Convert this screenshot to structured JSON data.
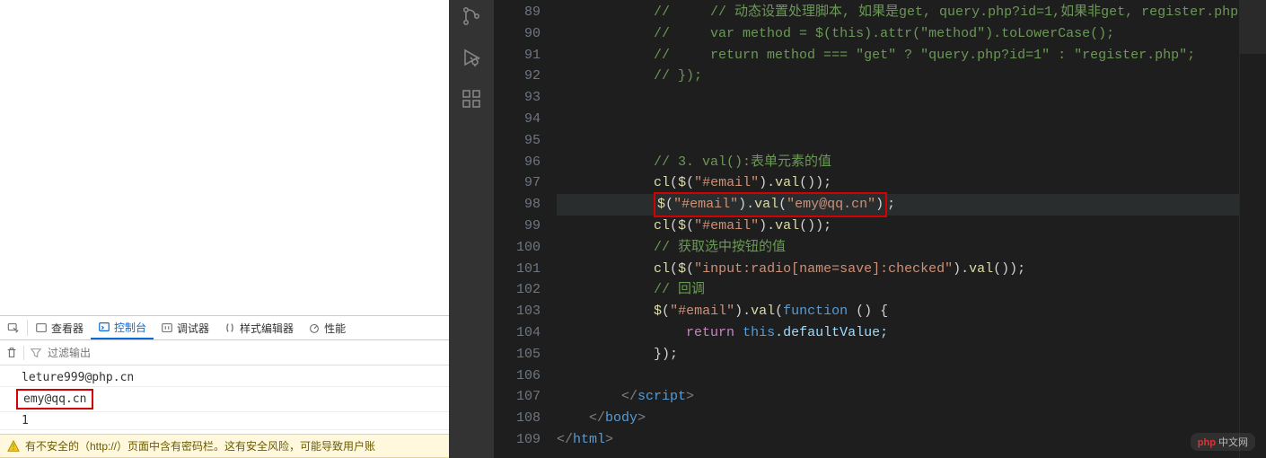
{
  "devtools": {
    "tabs": {
      "inspector": "查看器",
      "console": "控制台",
      "debugger": "调试器",
      "styleEditor": "样式编辑器",
      "performance": "性能"
    },
    "filterPlaceholder": "过滤输出",
    "console": {
      "line1": "leture999@php.cn",
      "line2": "emy@qq.cn",
      "line3": "1"
    },
    "warning": "有不安全的（http://）页面中含有密码栏。这有安全风险，可能导致用户账"
  },
  "editor": {
    "lines": {
      "89": {
        "cmt": "//     // 动态设置处理脚本, 如果是get, query.php?id=1,如果非get, register.php"
      },
      "90": {
        "cmt": "//     var method = $(this).attr(\"method\").toLowerCase();"
      },
      "91": {
        "cmt": "//     return method === \"get\" ? \"query.php?id=1\" : \"register.php\";"
      },
      "92": {
        "cmt": "// });"
      },
      "93": {
        "blank": ""
      },
      "94": {
        "blank": ""
      },
      "95": {
        "blank": ""
      },
      "96": {
        "cmt": "// 3. val():表单元素的值"
      },
      "97": {
        "a": "cl",
        "b": "(",
        "c": "$",
        "d": "(",
        "e": "\"#email\"",
        "f": ").",
        "g": "val",
        "h": "());"
      },
      "98": {
        "a": "$",
        "b": "(",
        "c": "\"#email\"",
        "d": ").",
        "e": "val",
        "f": "(",
        "g1": "\"emy@qq",
        "g2": ".cn\"",
        "h": ")",
        "i": ";"
      },
      "99": {
        "a": "cl",
        "b": "(",
        "c": "$",
        "d": "(",
        "e": "\"#email\"",
        "f": ").",
        "g": "val",
        "h": "());"
      },
      "100": {
        "cmt": "// 获取选中按钮的值"
      },
      "101": {
        "a": "cl",
        "b": "(",
        "c": "$",
        "d": "(",
        "e": "\"input:radio[name=save]:checked\"",
        "f": ").",
        "g": "val",
        "h": "());"
      },
      "102": {
        "cmt": "// 回调"
      },
      "103": {
        "a": "$",
        "b": "(",
        "c": "\"#email\"",
        "d": ").",
        "e": "val",
        "f": "(",
        "g": "function",
        "h": " () {"
      },
      "104": {
        "a": "return",
        "b": " ",
        "c": "this",
        "d": ".defaultValue;"
      },
      "105": {
        "a": "});"
      },
      "106": {
        "blank": ""
      },
      "107": {
        "open": "</",
        "name": "script",
        "close": ">"
      },
      "108": {
        "open": "</",
        "name": "body",
        "close": ">"
      },
      "109": {
        "open": "</",
        "name": "html",
        "close": ">"
      }
    },
    "lineNumbers": [
      "89",
      "90",
      "91",
      "92",
      "93",
      "94",
      "95",
      "96",
      "97",
      "98",
      "99",
      "100",
      "101",
      "102",
      "103",
      "104",
      "105",
      "106",
      "107",
      "108",
      "109"
    ]
  },
  "watermark": {
    "brand": "php",
    "text": " 中文网"
  }
}
